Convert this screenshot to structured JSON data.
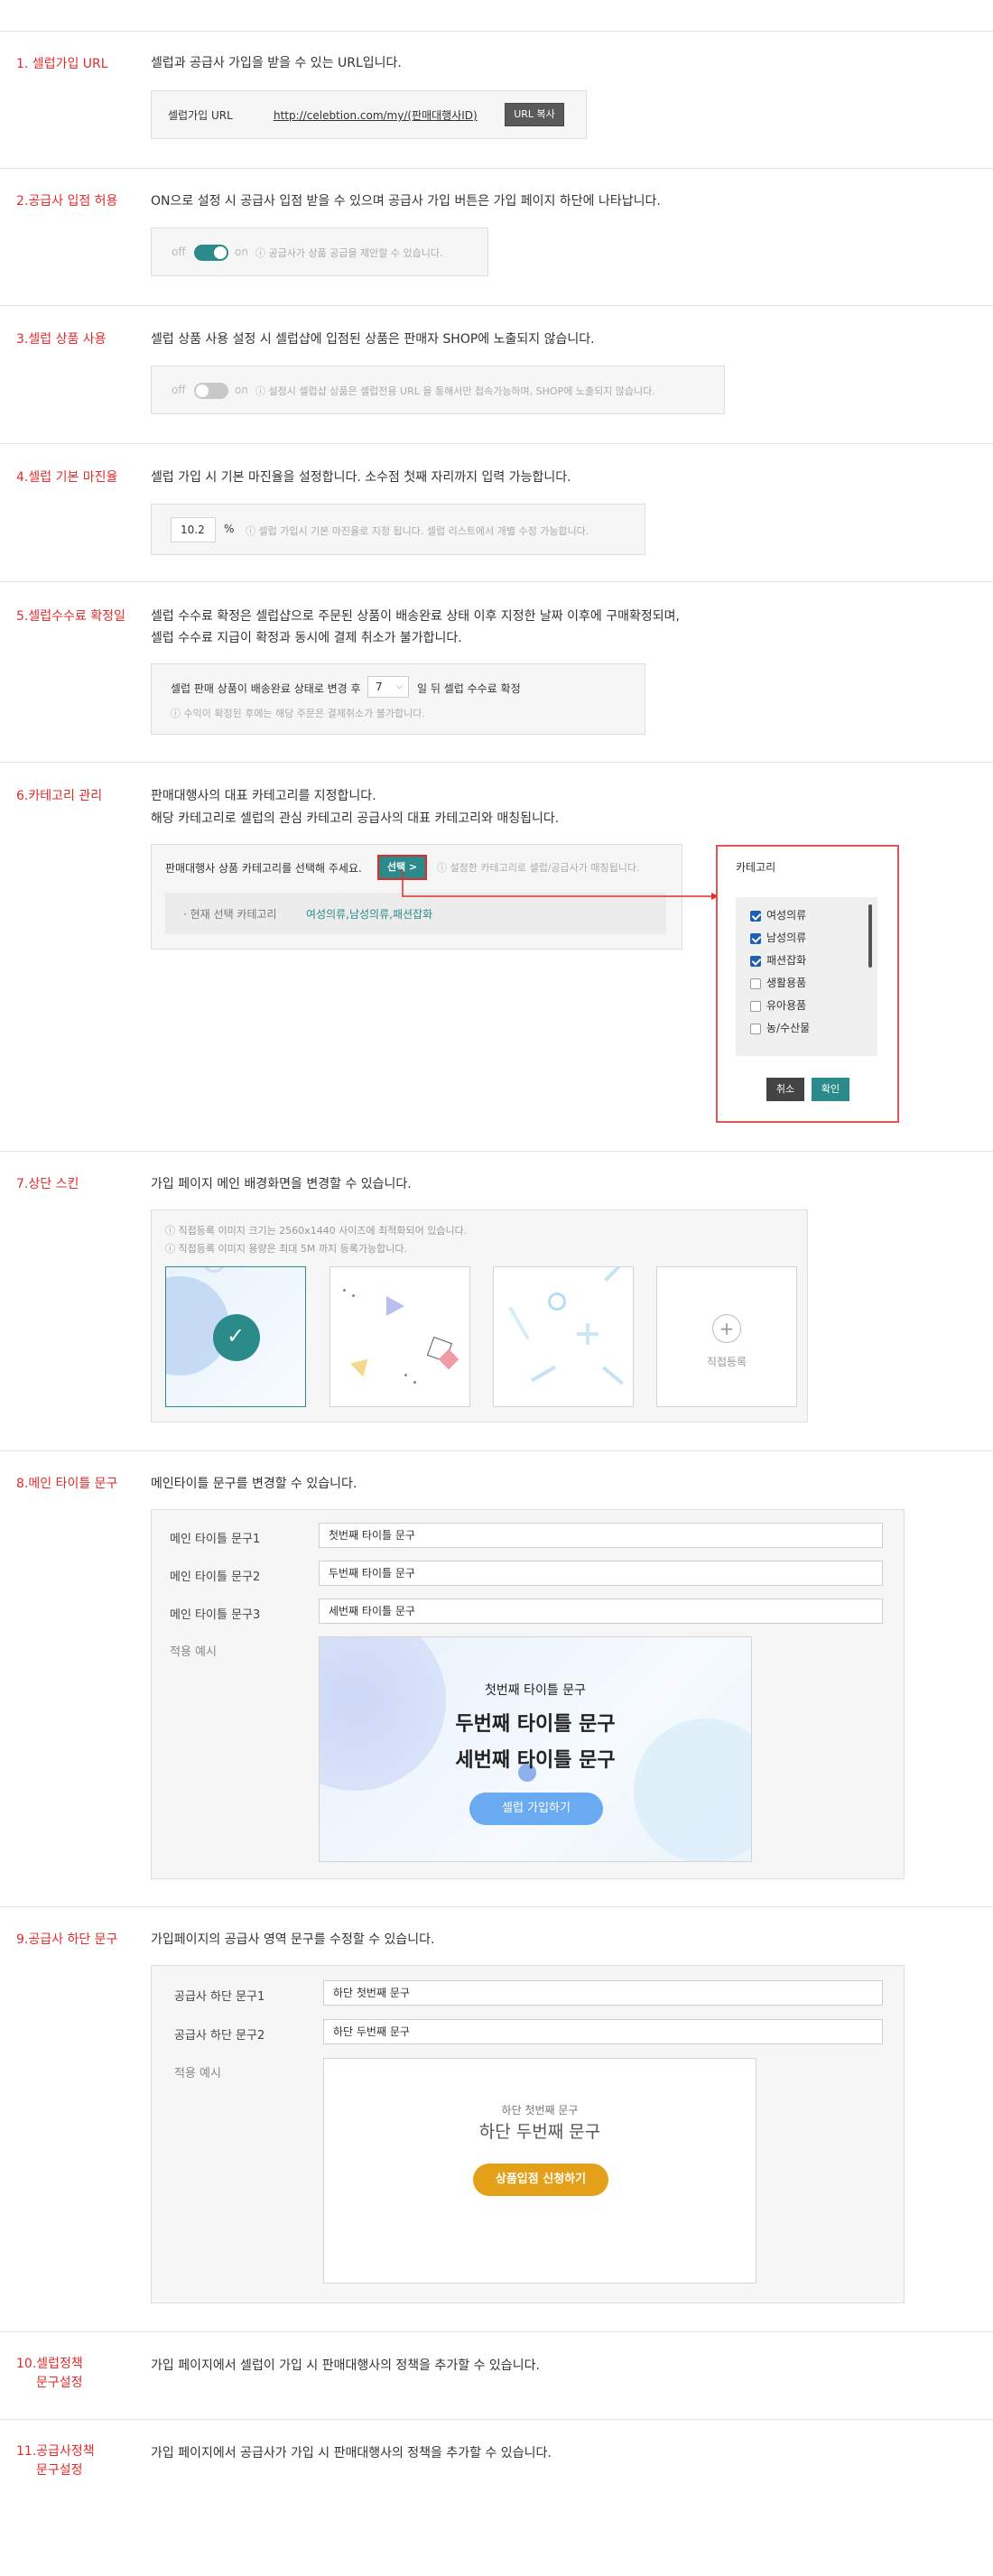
{
  "colors": {
    "accent_red": "#e02c2c",
    "teal": "#2b8a8a",
    "blue_cta": "#6aaaf0",
    "orange_cta": "#e3a018"
  },
  "s1": {
    "title": "1. 셀럽가입 URL",
    "desc": "셀럽과 공급사 가입을 받을 수 있는 URL입니다.",
    "label": "셀럽가입 URL",
    "url": "http://celebtion.com/my/(판매대행사ID)",
    "copy_btn": "URL 복사"
  },
  "s2": {
    "title": "2.공급사 입점 허용",
    "desc": "ON으로 설정 시 공급사 입점 받을 수 있으며 공급사 가입 버튼은 가입 페이지 하단에 나타납니다.",
    "off": "off",
    "on": "on",
    "note": "ⓘ 공급사가 상품 공급을 제안할 수 있습니다.",
    "enabled": true
  },
  "s3": {
    "title": "3.셀럽 상품 사용",
    "desc": "셀럽 상품 사용 설정 시 셀럽샵에 입점된 상품은 판매자 SHOP에 노출되지 않습니다.",
    "off": "off",
    "on": "on",
    "note": "ⓘ 설정시 셀럽샵 상품은 셀럽전용 URL 을 통해서만 접속가능하며, SHOP에 노출되지 않습니다.",
    "enabled": false
  },
  "s4": {
    "title": "4.셀럽 기본 마진율",
    "desc": "셀럽 가입 시 기본 마진율을 설정합니다. 소수점 첫째 자리까지 입력 가능합니다.",
    "value": "10.2",
    "unit": "%",
    "note": "ⓘ 셀럽 가입시 기본 마진율로 지정 됩니다. 셀럽 리스트에서 개별 수정 가능합니다."
  },
  "s5": {
    "title": "5.셀럽수수료 확정일",
    "desc1": "셀럽 수수료 확정은 셀럽샵으로 주문된 상품이 배송완료 상태 이후 지정한 날짜 이후에 구매확정되며,",
    "desc2": "셀럽 수수료 지급이 확정과 동시에 결제 취소가 불가합니다.",
    "prefix": "셀럽 판매 상품이 배송완료 상태로 변경 후",
    "days": "7",
    "suffix": "일 뒤 셀럽 수수료 확정",
    "note": "ⓘ 수익이 확정된 후에는 해당 주문은 결제취소가 불가합니다."
  },
  "s6": {
    "title": "6.카테고리 관리",
    "desc1": "판매대행사의 대표 카테고리를 지정합니다.",
    "desc2": "해당 카테고리로 셀럽의 관심 카테고리 공급사의 대표 카테고리와 매칭됩니다.",
    "prompt": "판매대행사 상품 카테고리를 선택해 주세요.",
    "select_btn": "선택 >",
    "select_note": "ⓘ 설정한 카테고리로 셀럽/공급사가 매칭됩니다.",
    "current_label": "· 현재 선택 카테고리",
    "current_value": "여성의류,남성의류,패션잡화",
    "popup_title": "카테고리",
    "items": [
      {
        "label": "여성의류",
        "checked": true
      },
      {
        "label": "남성의류",
        "checked": true
      },
      {
        "label": "패션잡화",
        "checked": true
      },
      {
        "label": "생활용품",
        "checked": false
      },
      {
        "label": "유아용품",
        "checked": false
      },
      {
        "label": "농/수산물",
        "checked": false
      }
    ],
    "cancel": "취소",
    "confirm": "확인"
  },
  "s7": {
    "title": "7.상단 스킨",
    "desc": "가입 페이지 메인 배경화면을 변경할 수 있습니다.",
    "note1": "ⓘ 직접등록 이미지 크기는 2560x1440 사이즈에 최적화되어 있습니다.",
    "note2": "ⓘ 직접등록 이미지 용량은 최대 5M 까지 등록가능합니다.",
    "upload": "직접등록"
  },
  "s8": {
    "title": "8.메인 타이틀 문구",
    "desc": "메인타이틀 문구를 변경할 수 있습니다.",
    "label1": "메인 타이틀 문구1",
    "label2": "메인 타이틀 문구2",
    "label3": "메인 타이틀 문구3",
    "value1": "첫번째 타이틀 문구",
    "value2": "두번째 타이틀 문구",
    "value3": "세번째 타이틀 문구",
    "preview_label": "적용 예시",
    "p1": "첫번째 타이틀 문구",
    "p2": "두번째 타이틀 문구",
    "p3": "세번째 타이틀 문구",
    "cta": "셀럽 가입하기"
  },
  "s9": {
    "title": "9.공급사 하단 문구",
    "desc": "가입페이지의 공급사 영역 문구를 수정할 수 있습니다.",
    "label1": "공급사 하단 문구1",
    "label2": "공급사 하단 문구2",
    "value1": "하단 첫번째 문구",
    "value2": "하단 두번째 문구",
    "preview_label": "적용 예시",
    "p1": "하단 첫번째 문구",
    "p2": "하단 두번째 문구",
    "cta": "상품입점 신청하기"
  },
  "s10": {
    "title1": "10.셀럽정책",
    "title2": "문구설정",
    "desc": "가입 페이지에서 셀럽이 가입 시 판매대행사의 정책을  추가할  수 있습니다."
  },
  "s11": {
    "title1": "11.공급사정책",
    "title2": "문구설정",
    "desc": "가입 페이지에서 공급사가 가입 시 판매대행사의 정책을  추가할  수 있습니다."
  }
}
